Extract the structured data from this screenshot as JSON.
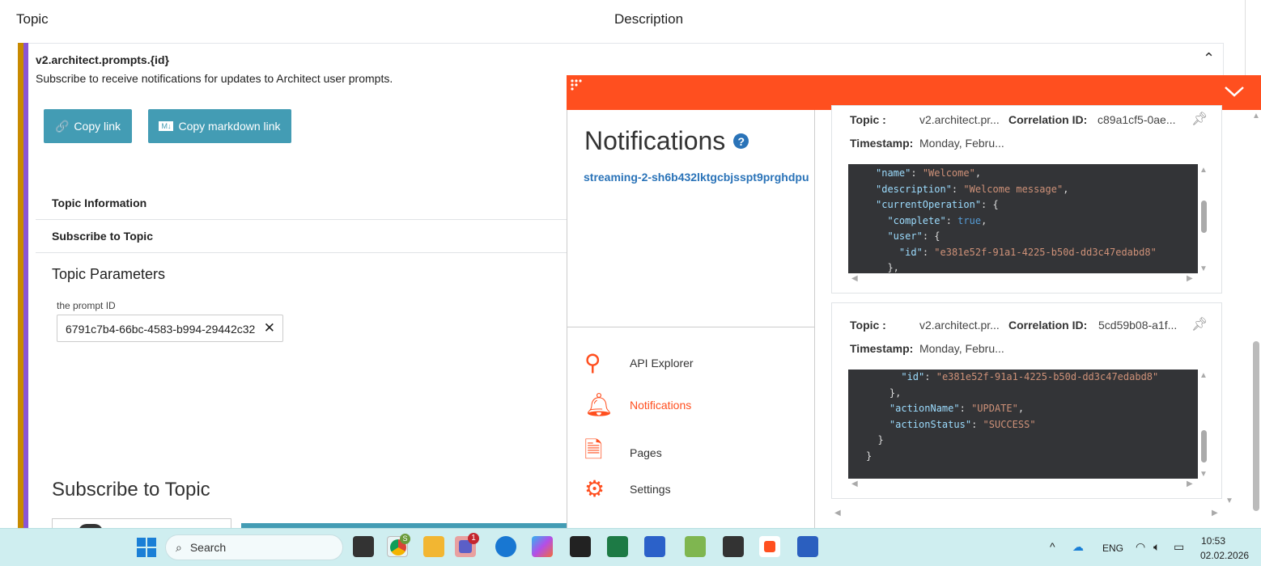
{
  "header": {
    "topic": "Topic",
    "description": "Description"
  },
  "topic": {
    "name": "v2.architect.prompts.{id}",
    "description": "Subscribe to receive notifications for updates to Architect user prompts.",
    "copy_link": "Copy link",
    "copy_markdown": "Copy markdown link",
    "sections": [
      "Topic Information",
      "Subscribe to Topic"
    ],
    "params_title": "Topic Parameters",
    "param_label": "the prompt ID",
    "param_value": "6791c7b4-66bc-4583-b994-29442c32",
    "subscribe_title": "Subscribe to Topic"
  },
  "panel": {
    "title": "Notifications",
    "channel": "streaming-2-sh6b432lktgcbjsspt9prghdpu",
    "nav": [
      {
        "label": "API Explorer",
        "icon": "api-explorer-icon"
      },
      {
        "label": "Notifications",
        "icon": "bell-icon"
      },
      {
        "label": "Pages",
        "icon": "pages-icon"
      },
      {
        "label": "Settings",
        "icon": "gear-icon"
      }
    ],
    "accent": "#ff4f1f"
  },
  "notifications": [
    {
      "topic_label": "Topic :",
      "topic": "v2.architect.pr...",
      "corr_label": "Correlation ID:",
      "corr": "c89a1cf5-0ae...",
      "ts_label": "Timestamp:",
      "ts": "Monday, Febru..."
    },
    {
      "topic_label": "Topic :",
      "topic": "v2.architect.pr...",
      "corr_label": "Correlation ID:",
      "corr": "5cd59b08-a1f...",
      "ts_label": "Timestamp:",
      "ts": "Monday, Febru..."
    }
  ],
  "taskbar": {
    "search": "Search",
    "lang": "ENG",
    "time": "10:53",
    "date": "02.02.2026",
    "teams_badge": "1",
    "chrome_badge": "S"
  }
}
